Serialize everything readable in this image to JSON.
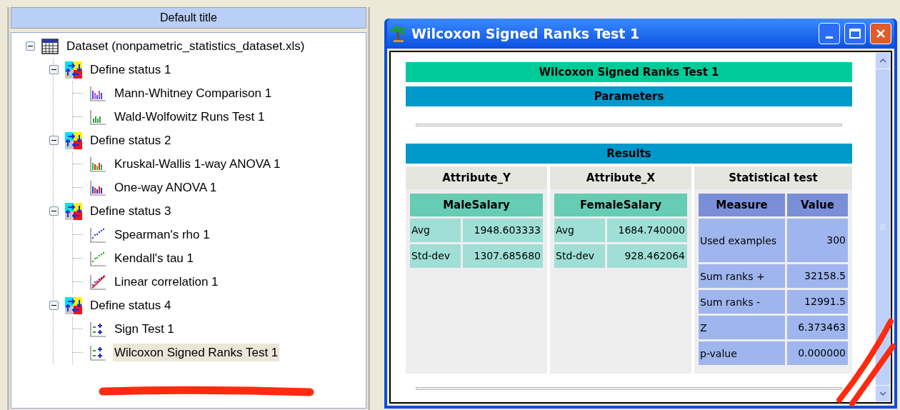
{
  "left_panel": {
    "title": "Default title",
    "tree": [
      {
        "label": "Dataset (nonpametric_statistics_dataset.xls)",
        "expanded": true,
        "selected": false,
        "children": [
          {
            "label": "Define status 1",
            "expanded": true,
            "selected": false,
            "children": [
              {
                "label": "Mann-Whitney Comparison 1",
                "selected": false
              },
              {
                "label": "Wald-Wolfowitz Runs Test 1",
                "selected": false
              }
            ]
          },
          {
            "label": "Define status 2",
            "expanded": true,
            "selected": false,
            "children": [
              {
                "label": "Kruskal-Wallis 1-way ANOVA 1",
                "selected": false
              },
              {
                "label": "One-way ANOVA 1",
                "selected": false
              }
            ]
          },
          {
            "label": "Define status 3",
            "expanded": true,
            "selected": false,
            "children": [
              {
                "label": "Spearman's rho 1",
                "selected": false
              },
              {
                "label": "Kendall's tau 1",
                "selected": false
              },
              {
                "label": "Linear correlation 1",
                "selected": false
              }
            ]
          },
          {
            "label": "Define status 4",
            "expanded": true,
            "selected": false,
            "children": [
              {
                "label": "Sign Test 1",
                "selected": false
              },
              {
                "label": "Wilcoxon Signed Ranks Test 1",
                "selected": true
              }
            ]
          }
        ]
      }
    ]
  },
  "window": {
    "title": "Wilcoxon Signed Ranks Test 1",
    "report": {
      "title": "Wilcoxon Signed Ranks Test 1",
      "parameters_heading": "Parameters",
      "results_heading": "Results",
      "attributes": [
        {
          "header": "Attribute_Y",
          "name": "MaleSalary",
          "rows": [
            {
              "label": "Avg",
              "value": "1948.603333"
            },
            {
              "label": "Std-dev",
              "value": "1307.685680"
            }
          ]
        },
        {
          "header": "Attribute_X",
          "name": "FemaleSalary",
          "rows": [
            {
              "label": "Avg",
              "value": "1684.740000"
            },
            {
              "label": "Std-dev",
              "value": "928.462064"
            }
          ]
        }
      ],
      "test": {
        "header": "Statistical test",
        "columns": [
          "Measure",
          "Value"
        ],
        "rows": [
          {
            "label": "Used examples",
            "value": "300"
          },
          {
            "label": "Sum ranks +",
            "value": "32158.5"
          },
          {
            "label": "Sum ranks -",
            "value": "12991.5"
          },
          {
            "label": "Z",
            "value": "6.373463"
          },
          {
            "label": "p-value",
            "value": "0.000000"
          }
        ]
      }
    }
  }
}
